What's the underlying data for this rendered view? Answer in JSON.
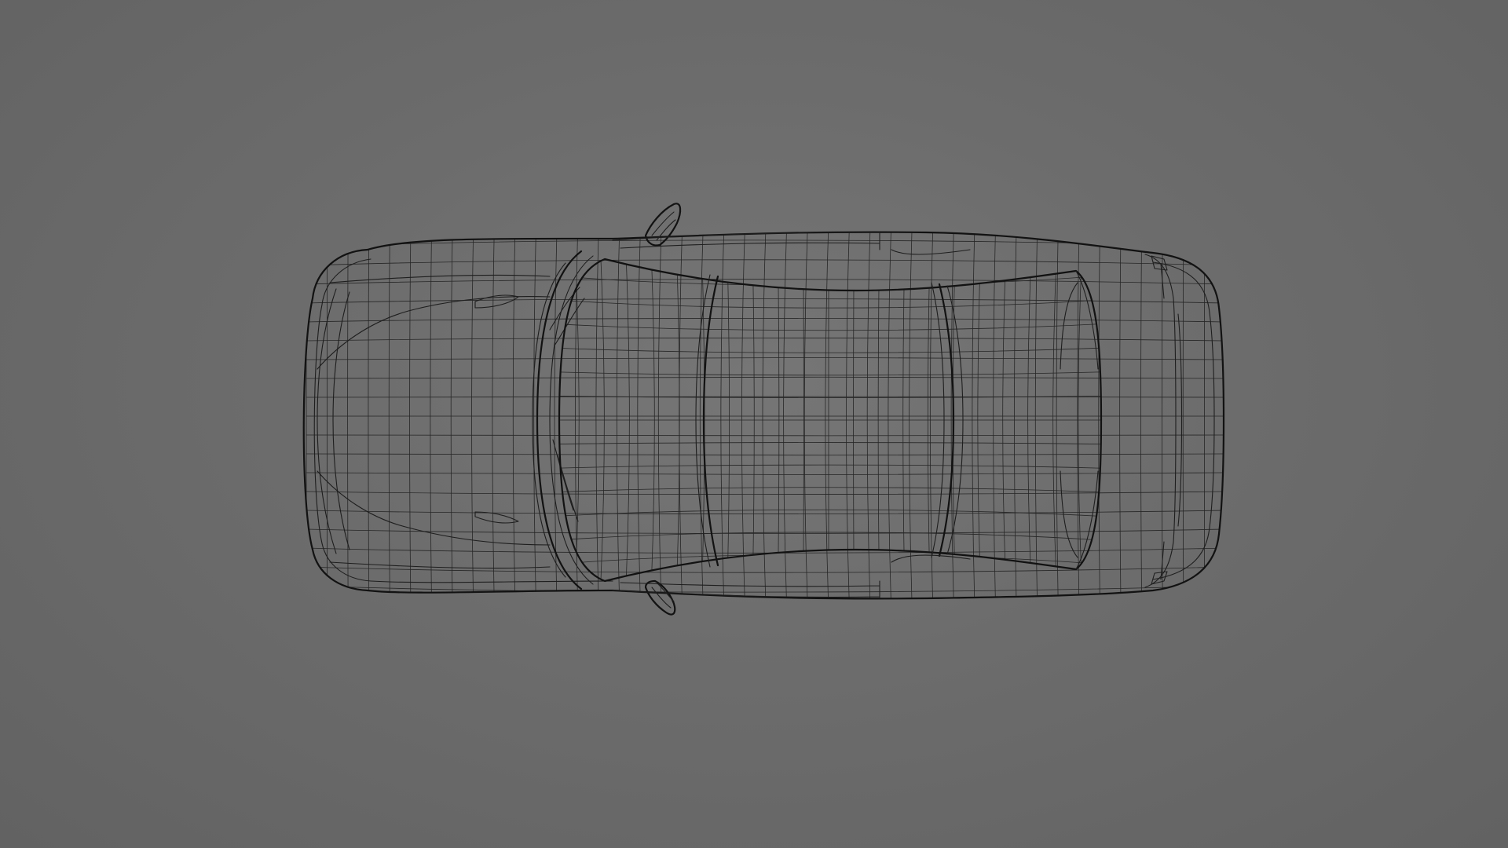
{
  "viewport": {
    "background_color": "#6c6c6c",
    "wire_color": "#1e1e1e",
    "view": "top",
    "shading": "wireframe"
  },
  "model": {
    "subject": "car-sedan",
    "body_mesh_columns": 44,
    "body_mesh_rows": 20
  }
}
